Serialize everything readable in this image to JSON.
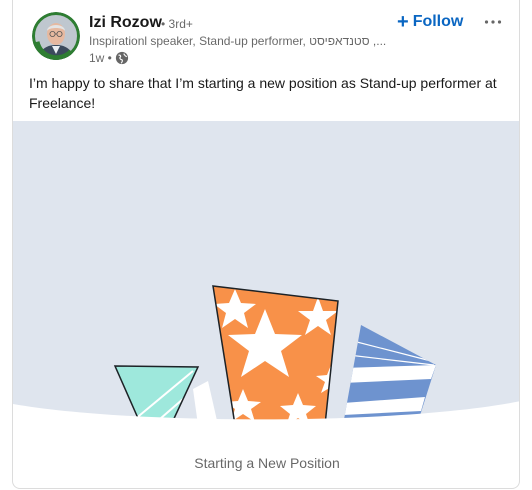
{
  "post": {
    "author": {
      "name": "Izi Rozow",
      "degree": "• 3rd+",
      "headline": "Inspirationl speaker, Stand-up performer, סטנדאפיסט ,...",
      "time": "1w •",
      "avatar_badge": "OPEN TO WORK",
      "visibility_icon": "globe-icon"
    },
    "follow_label": "Follow",
    "follow_icon": "plus-icon",
    "more_icon": "ellipsis-icon",
    "text": "I’m happy to share that I’m starting a new position as Stand-up performer at Freelance!",
    "media": {
      "caption": "Starting a New Position",
      "background_color": "#dfe5ee"
    }
  },
  "colors": {
    "accent": "#0a66c2",
    "open_to_work_green": "#2e7d32",
    "orange_gift": "#f89149",
    "teal_gift": "#9ee8dc",
    "blue_gift": "#6e93cf"
  }
}
